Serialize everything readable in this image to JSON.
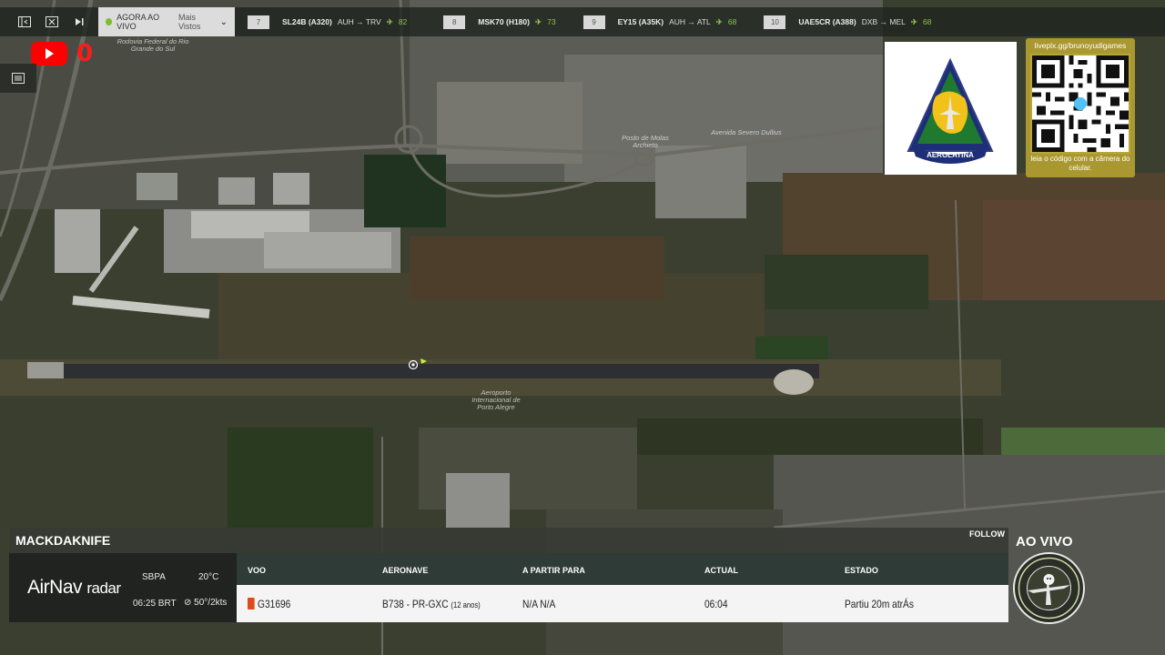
{
  "topbar": {
    "mode_label": "AGORA AO VIVO",
    "mode_sub": "Mais Vistos",
    "flights": [
      {
        "rank": "7",
        "callsign": "SL24B (A320)",
        "route": "AUH → TRV",
        "count": "82"
      },
      {
        "rank": "8",
        "callsign": "MSK70 (H180)",
        "route": "",
        "count": "73"
      },
      {
        "rank": "9",
        "callsign": "EY15 (A35K)",
        "route": "AUH → ATL",
        "count": "68"
      },
      {
        "rank": "10",
        "callsign": "UAE5CR (A388)",
        "route": "DXB → MEL",
        "count": "68"
      }
    ]
  },
  "youtube": {
    "count": "0"
  },
  "icons": {
    "collapse": "panel-collapse-icon",
    "screen": "screen-icon",
    "next": "skip-next-icon",
    "plane": "plane-icon",
    "youtube": "youtube-play-icon",
    "list": "list-icon"
  },
  "colors": {
    "live_green": "#8bc34a",
    "youtube_red": "#ff0000",
    "qr_gold": "#a9982f"
  },
  "logos": {
    "aerolatina": "AEROLATINA",
    "qr_url": "liveplx.gg/brunoyudigames",
    "qr_caption": "leia o código com a câmera do celular."
  },
  "map_labels": {
    "highway": "Rodovia Federal do Rio Grande do Sul",
    "airport": "Aeroporto Internacional de Porto Alegre",
    "gas": "Posto de Molas Archieto",
    "avenue": "Avenida Severo Dullius"
  },
  "panel": {
    "title": "MACKDAKNIFE",
    "follow": "FOLLOW",
    "brand": "AirNav",
    "brand_sub": "radar",
    "airport": "SBPA",
    "time": "06:25 BRT",
    "temp": "20°C",
    "wind": "50°/2kts",
    "headers": {
      "flight": "VOO",
      "aircraft": "AERONAVE",
      "from": "A PARTIR PARA",
      "actual": "ACTUAL",
      "status": "ESTADO"
    },
    "row": {
      "flight": "G31696",
      "aircraft": "B738 - PR-GXC",
      "aircraft_age": "(12 anos)",
      "from": "N/A N/A",
      "actual": "06:04",
      "status": "Partiu 20m atrÁs"
    }
  },
  "live": {
    "label": "AO VIVO"
  }
}
